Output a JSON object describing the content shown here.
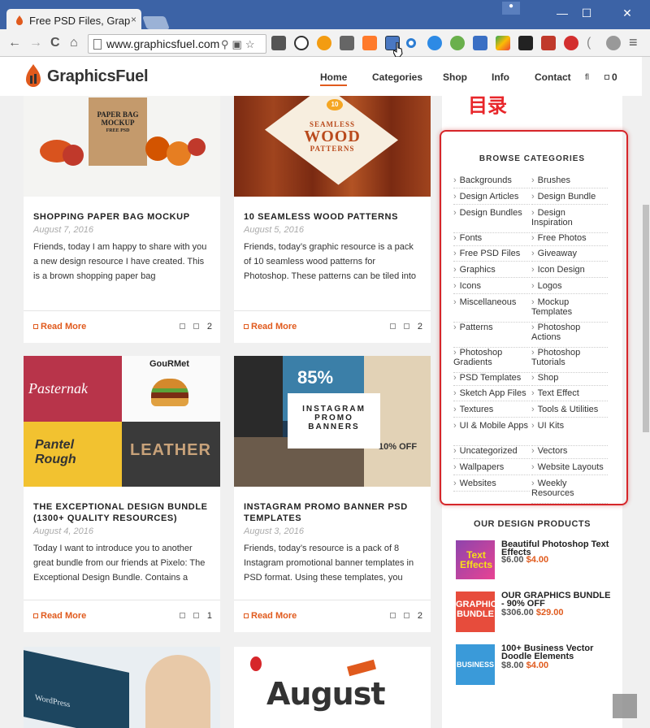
{
  "browser": {
    "tab_title": "Free PSD Files, Grap",
    "url": "www.graphicsfuel.com",
    "close_glyph": "×",
    "back_glyph": "←",
    "forward_glyph": "→",
    "reload_glyph": "C",
    "home_glyph": "⌂",
    "minimize_glyph": "—",
    "maximize_glyph": "☐",
    "window_close_glyph": "✕",
    "star_glyph": "☆",
    "menu_glyph": "≡"
  },
  "site": {
    "logo_text": "GraphicsFuel",
    "nav": [
      "Home",
      "Categories",
      "Shop",
      "Info",
      "Contact"
    ],
    "cart_count": "0",
    "nav_extra_glyph": "fl",
    "accent": "#e05a1d"
  },
  "posts": [
    {
      "title": "SHOPPING PAPER BAG MOCKUP",
      "date": "August 7, 2016",
      "excerpt": "Friends, today I am happy to share with you a new design resource I have created. This is a brown shopping paper bag",
      "more": "Read More",
      "comments": "2",
      "img_texts": [
        "PAPER BAG",
        "MOCKUP",
        "FREE PSD"
      ]
    },
    {
      "title": "10 SEAMLESS WOOD PATTERNS",
      "date": "August 5, 2016",
      "excerpt": "Friends, today’s graphic resource is a pack of 10 seamless wood patterns for Photoshop. These patterns can be tiled into",
      "more": "Read More",
      "comments": "2",
      "img_texts": [
        "10",
        "SEAMLESS",
        "WOOD",
        "PATTERNS"
      ]
    },
    {
      "title": "THE EXCEPTIONAL DESIGN BUNDLE (1300+ QUALITY RESOURCES)",
      "date": "August 4, 2016",
      "excerpt": "Today I want to introduce you to another great bundle from our friends at Pixelo: The Exceptional Design Bundle. Contains a",
      "more": "Read More",
      "comments": "1",
      "img_texts": [
        "Pasternak",
        "GouRMet",
        "Pantel Rough",
        "LEATHER"
      ]
    },
    {
      "title": "INSTAGRAM PROMO BANNER PSD TEMPLATES",
      "date": "August 3, 2016",
      "excerpt": "Friends, today’s resource is a pack of 8 Instagram promotional banner templates in PSD format. Using these templates, you",
      "more": "Read More",
      "comments": "2",
      "img_texts": [
        "INSTAGRAM",
        "PROMO",
        "BANNERS",
        "85%",
        "10% OFF"
      ]
    },
    {
      "title": "",
      "date": "",
      "excerpt": "",
      "more": "",
      "comments": "",
      "img_texts": [
        "WordPress"
      ]
    },
    {
      "title": "",
      "date": "",
      "excerpt": "",
      "more": "",
      "comments": "",
      "img_texts": [
        "August"
      ]
    }
  ],
  "annotation": {
    "text": "目录",
    "color": "#e8262a"
  },
  "sidebar": {
    "browse_title": "BROWSE CATEGORIES",
    "categories_left": [
      "Backgrounds",
      "Design Articles",
      "Design Bundles",
      "Fonts",
      "Free PSD Files",
      "Graphics",
      "Icons",
      "Miscellaneous",
      "Patterns",
      "Photoshop Gradients",
      "PSD Templates",
      "Sketch App Files",
      "Textures",
      "UI & Mobile Apps",
      "Uncategorized",
      "Wallpapers",
      "Websites"
    ],
    "categories_right": [
      "Brushes",
      "Design Bundle",
      "Design Inspiration",
      "Free Photos",
      "Giveaway",
      "Icon Design",
      "Logos",
      "Mockup Templates",
      "Photoshop Actions",
      "Photoshop Tutorials",
      "Shop",
      "Text Effect",
      "Tools & Utilities",
      "UI Kits",
      "Vectors",
      "Website Layouts",
      "Weekly Resources"
    ],
    "products_title": "OUR DESIGN PRODUCTS",
    "products": [
      {
        "name": "Beautiful Photoshop Text Effects",
        "old_price": "$6.00",
        "new_price": "$4.00",
        "thumb_text": "Text Effects"
      },
      {
        "name": "OUR GRAPHICS BUNDLE - 90% OFF",
        "old_price": "$306.00",
        "new_price": "$29.00",
        "thumb_text": "GRAPHIC BUNDLE"
      },
      {
        "name": "100+ Business Vector Doodle Elements",
        "old_price": "$8.00",
        "new_price": "$4.00",
        "thumb_text": "BUSINESS"
      }
    ]
  }
}
